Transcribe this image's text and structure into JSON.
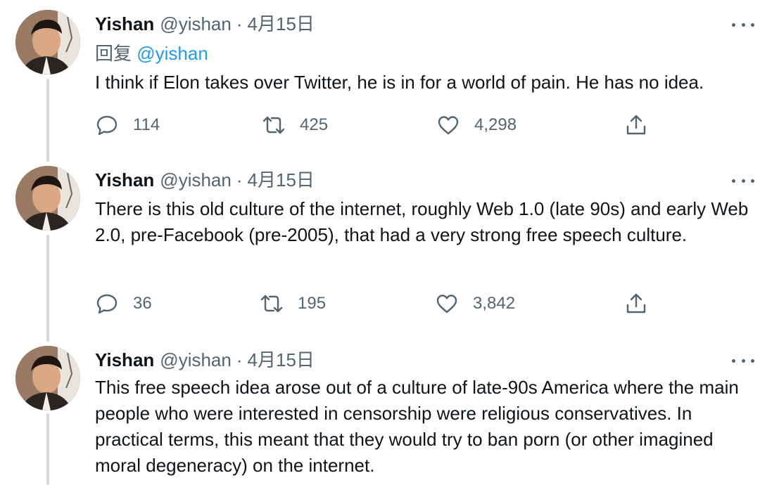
{
  "tweets": [
    {
      "author_name": "Yishan",
      "handle": "@yishan",
      "separator": "·",
      "date": "4月15日",
      "reply_prefix": "回复",
      "reply_mention": "@yishan",
      "text": "I think if Elon takes over Twitter, he is in for a world of pain.  He has no idea.",
      "replies": "114",
      "retweets": "425",
      "likes": "4,298"
    },
    {
      "author_name": "Yishan",
      "handle": "@yishan",
      "separator": "·",
      "date": "4月15日",
      "text": "There is this old culture of the internet, roughly Web 1.0 (late 90s) and early Web 2.0, pre-Facebook (pre-2005), that had a very strong free speech culture.",
      "replies": "36",
      "retweets": "195",
      "likes": "3,842"
    },
    {
      "author_name": "Yishan",
      "handle": "@yishan",
      "separator": "·",
      "date": "4月15日",
      "text": "This free speech idea arose out of a culture of late-90s America where the main people who were interested in censorship were religious conservatives.  In practical terms, this meant that they would try to ban porn (or other imagined moral degeneracy) on the internet."
    }
  ],
  "colors": {
    "text": "#0f1419",
    "secondary": "#536471",
    "link": "#1d9bf0",
    "thread_line": "#cfd9de"
  },
  "icons": {
    "reply": "reply-bubble-icon",
    "retweet": "retweet-icon",
    "like": "heart-icon",
    "share": "share-upload-icon",
    "more": "more-dots-icon"
  }
}
